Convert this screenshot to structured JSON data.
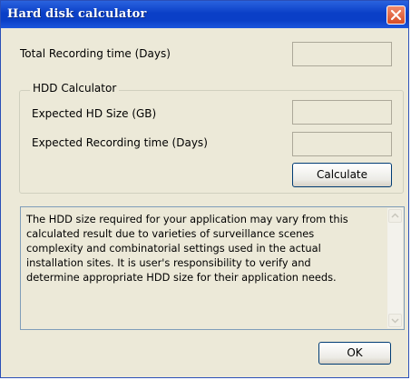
{
  "window": {
    "title": "Hard disk calculator"
  },
  "fields": {
    "total_recording_label": "Total Recording time (Days)",
    "total_recording_value": ""
  },
  "hdd_calculator": {
    "legend": "HDD Calculator",
    "hd_size_label": "Expected HD Size (GB)",
    "hd_size_value": "",
    "recording_time_label": "Expected Recording time (Days)",
    "recording_time_value": "",
    "calculate_label": "Calculate"
  },
  "notice": {
    "lines": [
      "The HDD size required for your application may vary from this",
      "calculated result due to varieties of surveillance scenes",
      "complexity and combinatorial settings used in the actual",
      "installation sites. It is user's responsibility to verify and",
      "determine appropriate HDD size for their application needs."
    ]
  },
  "footer": {
    "ok_label": "OK"
  },
  "colors": {
    "titlebar": "#0a3fc7",
    "close_button": "#d64d26",
    "dialog_bg": "#ece9d8"
  }
}
